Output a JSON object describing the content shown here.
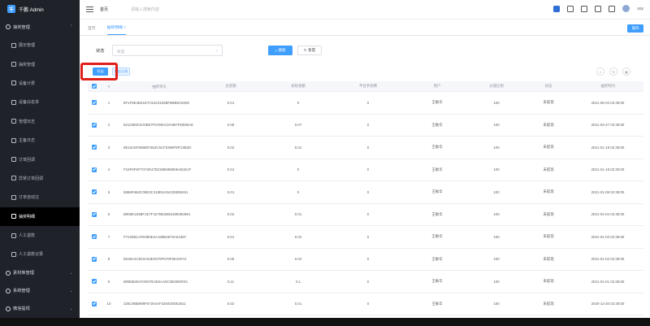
{
  "app": {
    "title": "千鹏 Admin"
  },
  "sidebar": {
    "groups": [
      {
        "label": "抽奖管理",
        "expanded": true,
        "items": [
          {
            "label": "展示管理"
          },
          {
            "label": "抽奖管理"
          },
          {
            "label": "设备计费"
          },
          {
            "label": "设备白名单"
          },
          {
            "label": "管理日志"
          },
          {
            "label": "主备日志"
          },
          {
            "label": "订单回调"
          },
          {
            "label": "异常订单回调"
          },
          {
            "label": "订单自动注"
          },
          {
            "label": "抽奖明细"
          },
          {
            "label": "人工退款"
          },
          {
            "label": "人工退款记录"
          }
        ]
      },
      {
        "label": "素材库管理"
      },
      {
        "label": "系统管理"
      },
      {
        "label": "微信提现"
      }
    ],
    "active_index": 9
  },
  "navbar": {
    "breadcrumb": "首页",
    "search_placeholder": "请输入搜索内容",
    "user": "suy"
  },
  "tabs": [
    {
      "label": "首页"
    },
    {
      "label": "抽奖明细"
    }
  ],
  "tabs_right_button": "操作",
  "filter": {
    "status_label": "状态",
    "status_placeholder": "状态",
    "search_label": "搜索",
    "reset_label": "重置"
  },
  "actions": {
    "fill_label": "导出",
    "record_label": "导出记录"
  },
  "table": {
    "headers": [
      "#",
      "抽奖单号",
      "总金额",
      "扣除金额",
      "平台手续费",
      "用户",
      "分成比例",
      "状态",
      "抽奖时间"
    ],
    "rows": [
      {
        "idx": "1",
        "no": "5F1F9E4B41E7C5423182BFB8B9C8208",
        "total": "0.01",
        "ded": "0",
        "plat": "0",
        "user": "王敏华",
        "rate": "100",
        "state": "未提现",
        "time": "2021-05-04 02:38:00"
      },
      {
        "idx": "2",
        "no": "8211969C0A0B67F5798AC0A987FEB95A8",
        "total": "0.08",
        "ded": "0.07",
        "plat": "0",
        "user": "王敏华",
        "rate": "100",
        "state": "未提现",
        "time": "2021-04-27 02:38:00"
      },
      {
        "idx": "3",
        "no": "9E15ADFB5BEF853C5CF0399F8FC9B3D",
        "total": "0.02",
        "ded": "0.01",
        "plat": "0",
        "user": "王敏华",
        "rate": "100",
        "state": "未提现",
        "time": "2021-01-18 02:38:00"
      },
      {
        "idx": "4",
        "no": "F19F9F5F7CF2E47BC888388905AB1E1F",
        "total": "0.01",
        "ded": "0",
        "plat": "0",
        "user": "王敏华",
        "rate": "100",
        "state": "未提现",
        "time": "2021-01-18 02:30:00"
      },
      {
        "idx": "5",
        "no": "8888F6B4C09E3C418E5A04238595261",
        "total": "0.01",
        "ded": "0",
        "plat": "0",
        "user": "王敏华",
        "rate": "100",
        "state": "未提现",
        "time": "2021-01-08 02:38:00"
      },
      {
        "idx": "6",
        "no": "B908E183BF1E7F427BE2B52489392894",
        "total": "0.02",
        "ded": "0.01",
        "plat": "0",
        "user": "王敏华",
        "rate": "100",
        "state": "未提现",
        "time": "2021-01-04 02:38:00"
      },
      {
        "idx": "7",
        "no": "F7228B1AFE890E2A189B4876A61887",
        "total": "0.01",
        "ded": "0.02",
        "plat": "0",
        "user": "王敏华",
        "rate": "100",
        "state": "未提现",
        "time": "2021-01-03 02:38:00"
      },
      {
        "idx": "8",
        "no": "5E39A4C823A53E0379F678F5E10FA2",
        "total": "0.09",
        "ded": "0.04",
        "plat": "0",
        "user": "王敏华",
        "rate": "100",
        "state": "未提现",
        "time": "2021-01-02 02:38:00"
      },
      {
        "idx": "9",
        "no": "B0B5B45AF2E07E4E6AADCBD805FEC",
        "total": "0.11",
        "ded": "0.1",
        "plat": "0",
        "user": "王敏华",
        "rate": "100",
        "state": "未提现",
        "time": "2021-01-01 02:38:00"
      },
      {
        "idx": "10",
        "no": "325C9BB999F67264AF32840D0E3611",
        "total": "0.02",
        "ded": "0.01",
        "plat": "0",
        "user": "王敏华",
        "rate": "100",
        "state": "未提现",
        "time": "2020-12-30 02:38:00"
      }
    ]
  },
  "colors": {
    "primary": "#409eff",
    "sidebar_bg": "#1f2329",
    "highlight": "#e0201b"
  }
}
